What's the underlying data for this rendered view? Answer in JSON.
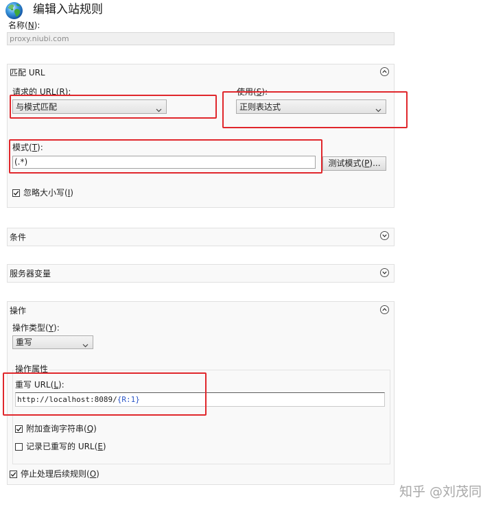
{
  "window": {
    "title": "编辑入站规则",
    "icon": "globe-icon"
  },
  "name": {
    "label": "名称(N):",
    "value": "proxy.niubi.com"
  },
  "match_url": {
    "header": "匹配 URL",
    "toggle_icon": "chevron-up-icon",
    "requested_url": {
      "label": "请求的 URL(R):",
      "selected": "与模式匹配",
      "icon": "dropdown-arrow-icon"
    },
    "using": {
      "label": "使用(S):",
      "selected": "正则表达式",
      "icon": "dropdown-arrow-icon"
    },
    "pattern": {
      "label": "模式(T):",
      "value": "(.*)"
    },
    "test_pattern_button": "测试模式(P)...",
    "ignore_case": {
      "label": "忽略大小写(I)",
      "checked": true
    }
  },
  "conditions": {
    "header": "条件",
    "toggle_icon": "chevron-down-icon"
  },
  "server_variables": {
    "header": "服务器变量",
    "toggle_icon": "chevron-down-icon"
  },
  "action": {
    "header": "操作",
    "toggle_icon": "chevron-up-icon",
    "action_type": {
      "label": "操作类型(Y):",
      "selected": "重写",
      "icon": "dropdown-arrow-icon"
    },
    "properties": {
      "title": "操作属性",
      "rewrite_url": {
        "label": "重写 URL(L):",
        "value": "http://localhost:8089/{R:1}"
      },
      "append_query_string": {
        "label": "附加查询字符串(Q)",
        "checked": true
      },
      "log_rewritten_url": {
        "label": "记录已重写的 URL(E)",
        "checked": false
      }
    },
    "stop_processing": {
      "label": "停止处理后续规则(O)",
      "checked": true
    }
  },
  "watermark": "知乎 @刘茂同",
  "colors": {
    "highlight": "#e0262b",
    "server_variable": "#2a55c8",
    "panel_background": "#f9f9f9"
  }
}
